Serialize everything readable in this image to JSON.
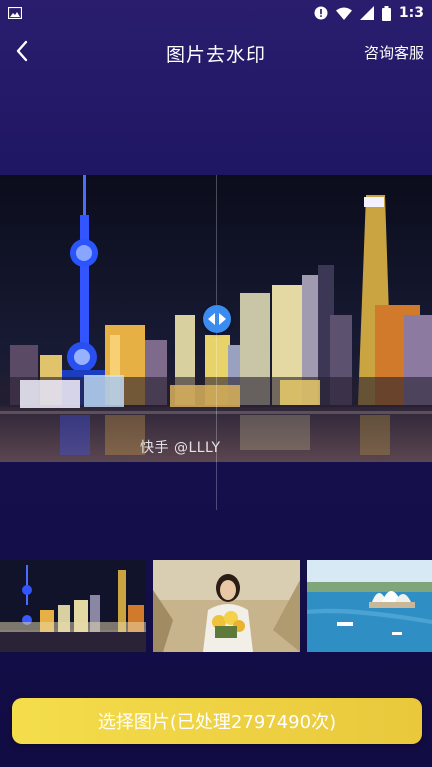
{
  "status_bar": {
    "time": "1:3",
    "icons": [
      "image-icon",
      "alert-icon",
      "wifi-icon",
      "signal-icon",
      "battery-icon"
    ]
  },
  "header": {
    "title": "图片去水印",
    "consult_label": "咨询客服",
    "back_icon": "chevron-left-icon"
  },
  "preview": {
    "watermark_text": "快手 @LLLY"
  },
  "samples": [
    {
      "name": "shanghai-night"
    },
    {
      "name": "portrait-field"
    },
    {
      "name": "sydney-opera-house"
    }
  ],
  "action": {
    "select_label": "选择图片(已处理2797490次)"
  },
  "colors": {
    "background": "#1c1560",
    "accent_button": "#f0d646",
    "handle": "#3b8cf0"
  }
}
